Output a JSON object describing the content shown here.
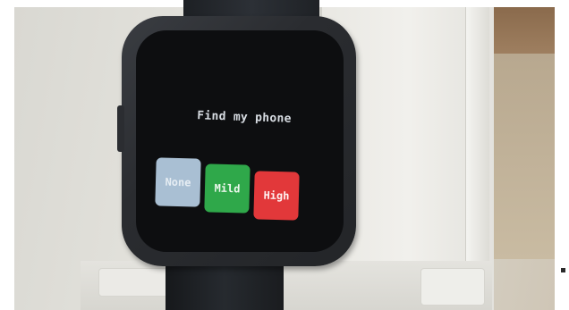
{
  "screen": {
    "title": "Find my phone"
  },
  "buttons": [
    {
      "label": "None",
      "color": "#a9bfd3"
    },
    {
      "label": "Mild",
      "color": "#2fa84a"
    },
    {
      "label": "High",
      "color": "#e2383a"
    }
  ]
}
